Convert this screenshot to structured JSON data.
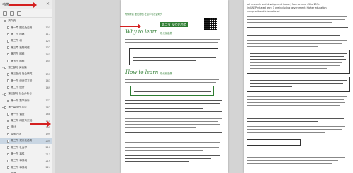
{
  "sidebar": {
    "title": "书签",
    "close_glyph": "✕",
    "items": [
      {
        "label": "简介页",
        "page": "",
        "caret": "",
        "selected": false
      },
      {
        "label": "第一章 图论及应用",
        "page": "101",
        "caret": "",
        "selected": false
      },
      {
        "label": "第二节 回路",
        "page": "117",
        "caret": "",
        "selected": false
      },
      {
        "label": "第三节 树",
        "page": "125",
        "caret": "",
        "selected": false
      },
      {
        "label": "第三章 独特网络",
        "page": "132",
        "caret": "",
        "selected": false
      },
      {
        "label": "第四节 网络",
        "page": "141",
        "caret": "",
        "selected": false
      },
      {
        "label": "第五节 网络",
        "page": "145",
        "caret": "",
        "selected": false
      },
      {
        "label": "第二部分 阅读篇",
        "page": "",
        "caret": "▾",
        "selected": false
      },
      {
        "label": "第三部分 社会研究",
        "page": "157",
        "caret": "",
        "selected": false
      },
      {
        "label": "第一节 统计学方法",
        "page": "163",
        "caret": "",
        "selected": false
      },
      {
        "label": "第二节 统计",
        "page": "169",
        "caret": "",
        "selected": false
      },
      {
        "label": "第三部分 社会分析与",
        "page": "",
        "caret": "▾",
        "selected": false
      },
      {
        "label": "第一节 数学分析",
        "page": "177",
        "caret": "",
        "selected": false
      },
      {
        "label": "第一章 研究方法",
        "page": "182",
        "caret": "▾",
        "selected": false
      },
      {
        "label": "第一节 调查",
        "page": "188",
        "caret": "",
        "selected": false
      },
      {
        "label": "第二节 研究与实验",
        "page": "191",
        "caret": "",
        "selected": false
      },
      {
        "label": "统计",
        "page": "195",
        "caret": "",
        "selected": false
      },
      {
        "label": "实验方法",
        "page": "199",
        "caret": "",
        "selected": false
      },
      {
        "label": "第二节 现代化趋势",
        "page": "204",
        "caret": "",
        "selected": true
      },
      {
        "label": "第三节 社会学",
        "page": "210",
        "caret": "",
        "selected": false
      },
      {
        "label": "第一节 事件",
        "page": "213",
        "caret": "",
        "selected": false
      },
      {
        "label": "第二节 事件线",
        "page": "219",
        "caret": "",
        "selected": false
      },
      {
        "label": "第三节 事件线",
        "page": "224",
        "caret": "",
        "selected": false
      },
      {
        "label": "附录",
        "page": "231",
        "caret": "",
        "selected": false
      }
    ]
  },
  "left_page": {
    "header": "为你所需 理论基础 社会学与社会研究",
    "chapter_tag": "第二节 现代化趋势",
    "why_heading": "Why to learn",
    "why_cn": "现代化趋势",
    "how_heading": "How to learn",
    "how_cn": "现代化趋势"
  },
  "right_page": {
    "line1": "all research and development funds | from around 45 to 25%.",
    "line2": "in UNEP-related work 1 are including government, higher education,",
    "line3": "non-profit and international",
    "quote1": "A new study published in the journal Child Development, by Caitlin Crone of the University of Leiden and colleagues, suggests that",
    "quote2": "A new study published in the journal Child Development, by Caitlin Crone of the University of Leiden and colleagues",
    "fill_in": "the positive and negative roles of teenagers",
    "section": "语篇",
    "note": "positive or negative"
  },
  "colors": {
    "accent": "#2e7d32",
    "arrow": "#d42020",
    "selected": "#c9d6e3"
  }
}
